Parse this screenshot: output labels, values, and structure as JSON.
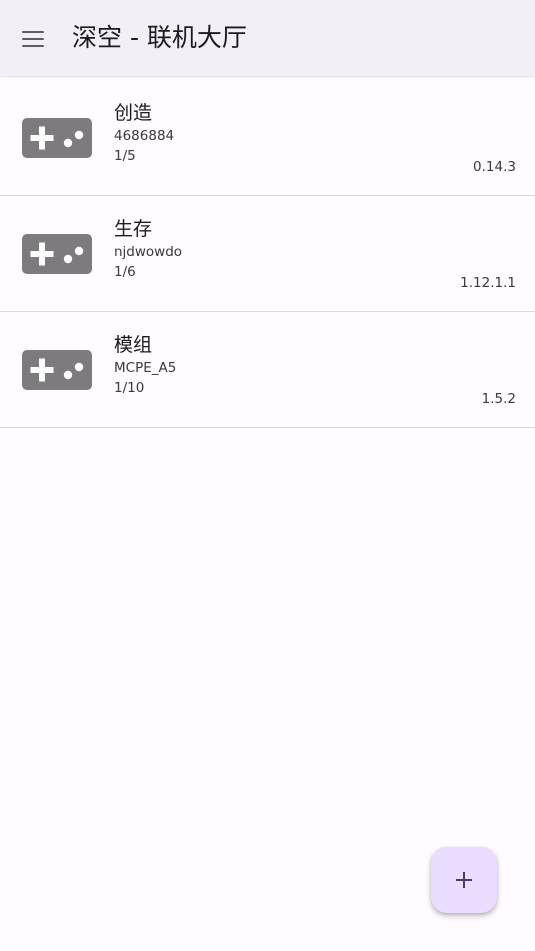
{
  "app": {
    "title": "深空 - 联机大厅",
    "menu_icon": "hamburger-menu-icon",
    "fab_icon": "plus-icon"
  },
  "colors": {
    "background": "#fffbfe",
    "topbar": "#f3eff6",
    "icon_gray": "#7d7b7e",
    "fab_bg": "#eaddff",
    "fab_icon": "#4a3a6b"
  },
  "rooms": [
    {
      "name": "创造",
      "id": "4686884",
      "players": "1/5",
      "version": "0.14.3",
      "icon": "gamepad-icon"
    },
    {
      "name": "生存",
      "id": "njdwowdo",
      "players": "1/6",
      "version": "1.12.1.1",
      "icon": "gamepad-icon"
    },
    {
      "name": "模组",
      "id": "MCPE_A5",
      "players": "1/10",
      "version": "1.5.2",
      "icon": "gamepad-icon"
    }
  ]
}
